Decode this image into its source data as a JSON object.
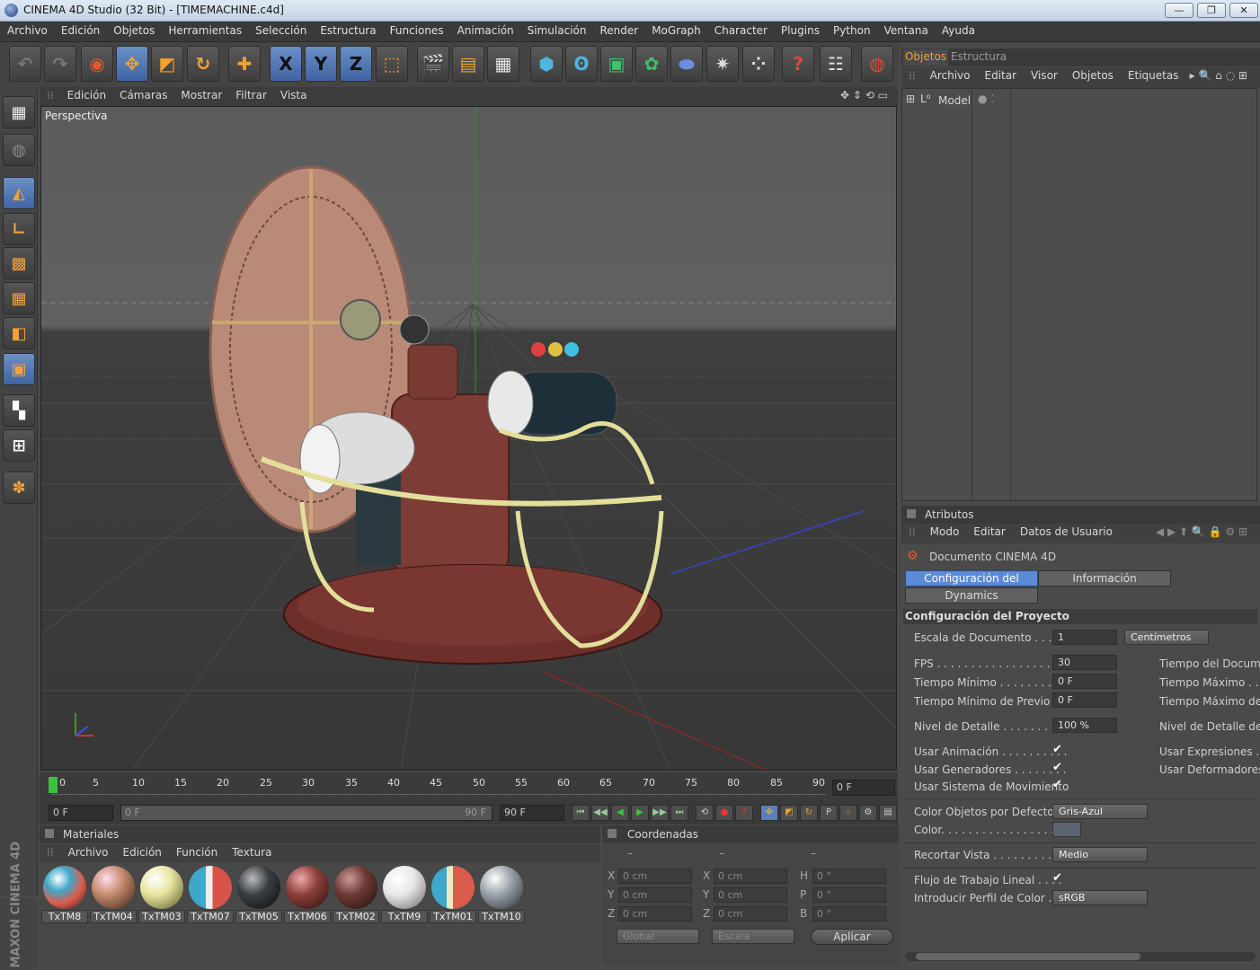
{
  "window": {
    "title": "CINEMA 4D Studio (32 Bit) - [TIMEMACHINE.c4d]",
    "controls": [
      "—",
      "❐",
      "✕"
    ]
  },
  "menu": [
    "Archivo",
    "Edición",
    "Objetos",
    "Herramientas",
    "Selección",
    "Estructura",
    "Funciones",
    "Animación",
    "Simulación",
    "Render",
    "MoGraph",
    "Character",
    "Plugins",
    "Python",
    "Ventana",
    "Ayuda"
  ],
  "toolbar": {
    "axis_x": "X",
    "axis_y": "Y",
    "axis_z": "Z"
  },
  "viewport": {
    "menu": [
      "Edición",
      "Cámaras",
      "Mostrar",
      "Filtrar",
      "Vista"
    ],
    "label": "Perspectiva"
  },
  "timeline": {
    "ticks": [
      "0",
      "5",
      "10",
      "15",
      "20",
      "25",
      "30",
      "35",
      "40",
      "45",
      "50",
      "55",
      "60",
      "65",
      "70",
      "75",
      "80",
      "85",
      "90"
    ],
    "current_frame": "0 F",
    "start": "0 F",
    "range_start": "0 F",
    "range_end": "90 F",
    "end": "90 F"
  },
  "materials": {
    "title": "Materiales",
    "menu": [
      "Archivo",
      "Edición",
      "Función",
      "Textura"
    ],
    "items": [
      {
        "name": "TxTM8",
        "color": "#3fa7c9"
      },
      {
        "name": "TxTM04",
        "color": "#c48a6c"
      },
      {
        "name": "TxTM03",
        "color": "#e8e6a0"
      },
      {
        "name": "TxTM07",
        "color": "#d8534a"
      },
      {
        "name": "TxTM05",
        "color": "#3a3f44"
      },
      {
        "name": "TxTM06",
        "color": "#8c3f3a"
      },
      {
        "name": "TxTM02",
        "color": "#6e3a34"
      },
      {
        "name": "TxTM9",
        "color": "#e8e8e8"
      },
      {
        "name": "TxTM01",
        "color": "#d95b4c"
      },
      {
        "name": "TxTM10",
        "color": "#9aa2aa"
      }
    ]
  },
  "coordinates": {
    "title": "Coordenadas",
    "dashes": [
      "–",
      "–",
      "–"
    ],
    "rows": [
      {
        "a": "X",
        "av": "0 cm",
        "b": "X",
        "bv": "0 cm",
        "c": "H",
        "cv": "0 °"
      },
      {
        "a": "Y",
        "av": "0 cm",
        "b": "Y",
        "bv": "0 cm",
        "c": "P",
        "cv": "0 °"
      },
      {
        "a": "Z",
        "av": "0 cm",
        "b": "Z",
        "bv": "0 cm",
        "c": "B",
        "cv": "0 °"
      }
    ],
    "mode1": "Global",
    "mode2": "Escala",
    "apply": "Aplicar"
  },
  "objects": {
    "tabs": [
      "Objetos",
      "Estructura"
    ],
    "menu": [
      "Archivo",
      "Editar",
      "Visor",
      "Objetos",
      "Etiquetas"
    ],
    "tree_item": "Model"
  },
  "attributes": {
    "title": "Atributos",
    "menu": [
      "Modo",
      "Editar",
      "Datos de Usuario"
    ],
    "doc": "Documento CINEMA 4D",
    "tabs": [
      "Configuración del Proyecto",
      "Información",
      "Dynamics"
    ],
    "section": "Configuración del Proyecto",
    "escala_label": "Escala de Documento . . . . .",
    "escala_value": "1",
    "escala_unit": "Centímetros",
    "fps_label": "FPS . . . . . . . . . . . . . . . . .",
    "fps_value": "30",
    "tmin_label": "Tiempo Mínimo . . . . . . . . .",
    "tmin_value": "0 F",
    "tminp_label": "Tiempo Mínimo de Previo . .",
    "tminp_value": "0 F",
    "nivel_label": "Nivel de Detalle . . . . . . . . .",
    "nivel_value": "100 %",
    "right_labels": [
      "Tiempo del Documen",
      "Tiempo Máximo . . . .",
      "Tiempo Máximo de P",
      "Nivel de Detalle del F",
      "Usar Expresiones . . .",
      "Usar Deformadores . ."
    ],
    "anim_label": "Usar Animación . . . . . . . . . .",
    "gen_label": "Usar Generadores . . . . . . . .",
    "mov_label": "Usar Sistema de Movimiento",
    "check": "✔",
    "color_def_label": "Color Objetos por Defecto . .",
    "color_def_value": "Gris-Azul",
    "color_label": "Color. . . . . . . . . . . . . . . . .",
    "recortar_label": "Recortar Vista . . . . . . . . . .",
    "recortar_value": "Medio",
    "flujo_label": "Flujo de Trabajo Lineal . . . .",
    "perfil_label": "Introducir Perfil de Color . . .",
    "perfil_value": "sRGB"
  },
  "branding": "MAXON CINEMA 4D"
}
